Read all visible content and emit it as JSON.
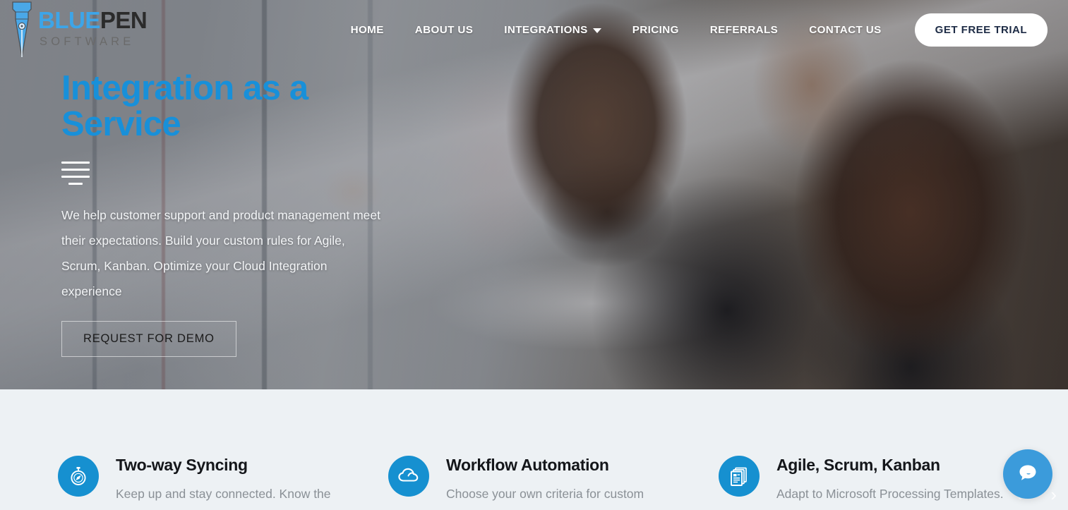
{
  "brand": {
    "name_part1": "BLUE",
    "name_part2": "PEN",
    "tagline": "SOFTWARE",
    "blue": "#3da5e8",
    "dark": "#2b2b2b",
    "logo_icon": "fountain-pen-nib-icon"
  },
  "nav": {
    "items": [
      {
        "label": "HOME",
        "has_dropdown": false
      },
      {
        "label": "ABOUT US",
        "has_dropdown": false
      },
      {
        "label": "INTEGRATIONS",
        "has_dropdown": true
      },
      {
        "label": "PRICING",
        "has_dropdown": false
      },
      {
        "label": "REFERRALS",
        "has_dropdown": false
      },
      {
        "label": "CONTACT US",
        "has_dropdown": false
      }
    ],
    "cta_label": "GET FREE TRIAL"
  },
  "hero": {
    "title": "Integration as a Service",
    "title_color": "#1890d9",
    "description": "We help customer support and product management meet their expectations. Build your custom rules for Agile, Scrum, Kanban. Optimize your Cloud Integration experience",
    "button_label": "REQUEST FOR DEMO",
    "prev_arrow": "‹",
    "next_arrow": "›"
  },
  "features": {
    "background": "#edf1f4",
    "icon_color": "#1690d0",
    "items": [
      {
        "icon": "compass-icon",
        "title": "Two-way Syncing",
        "description": "Keep up and stay connected. Know the"
      },
      {
        "icon": "cloud-icon",
        "title": "Workflow Automation",
        "description": "Choose your own criteria for custom"
      },
      {
        "icon": "documents-icon",
        "title": "Agile, Scrum, Kanban",
        "description": "Adapt to Microsoft Processing Templates."
      }
    ]
  },
  "chat": {
    "icon": "chat-bubble-icon",
    "color": "#3b9bdb"
  }
}
